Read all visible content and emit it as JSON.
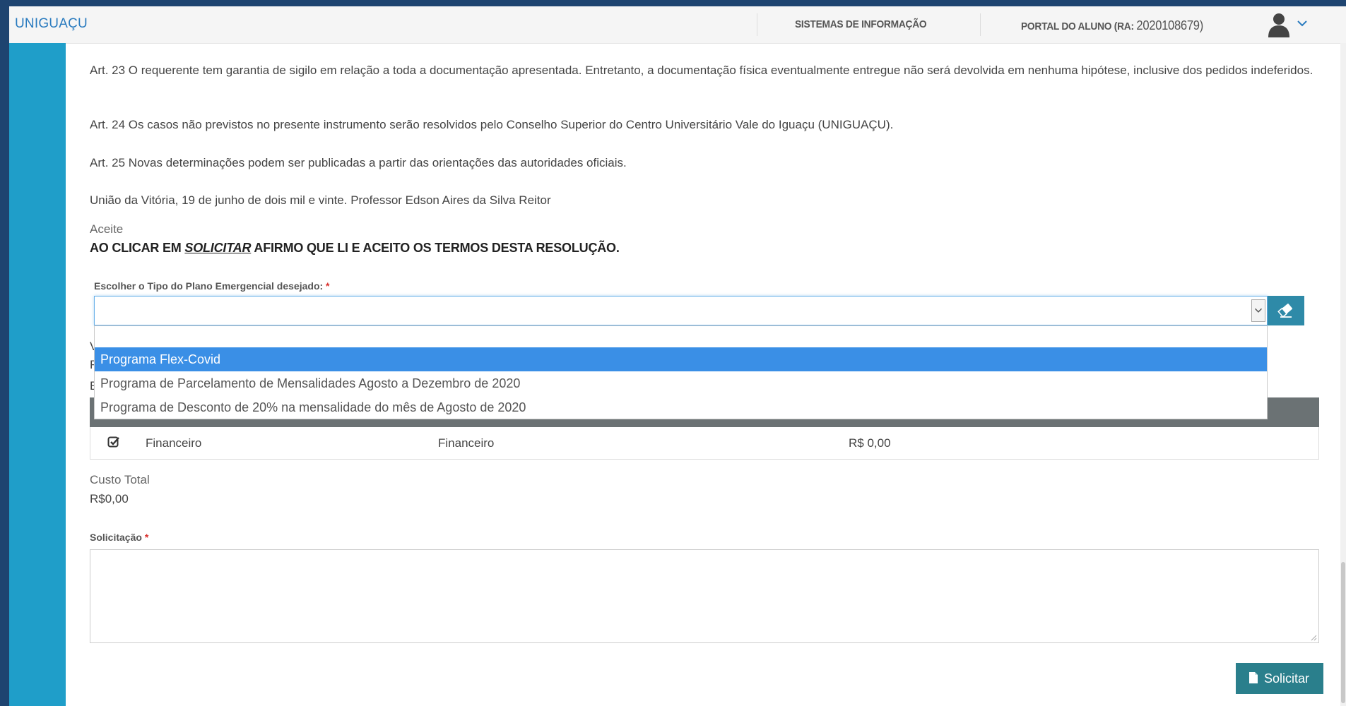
{
  "header": {
    "brand": "UNIGUAÇU",
    "nav_sistemas": "SISTEMAS DE INFORMAÇÃO",
    "nav_portal_prefix": "PORTAL DO ALUNO (RA:",
    "nav_portal_ra": "2020108679)",
    "user_icon": "user-icon",
    "menu_icon": "chevron-down-icon"
  },
  "content": {
    "art23": "Art. 23 O requerente tem garantia de sigilo em relação a toda a documentação apresentada. Entretanto, a documentação física eventualmente entregue não será devolvida em nenhuma hipótese, inclusive dos pedidos indeferidos.",
    "art24": "Art. 24 Os casos não previstos no presente instrumento serão resolvidos pelo Conselho Superior do Centro Universitário Vale do Iguaçu (UNIGUAÇU).",
    "art25": "Art. 25 Novas determinações podem ser publicadas a partir das orientações das autoridades oficiais.",
    "signature": "União da Vitória, 19 de junho de dois mil e vinte. Professor Edson Aires da Silva Reitor",
    "aceite_label": "Aceite",
    "aceite_pre": "AO CLICAR EM ",
    "aceite_em": "SOLICITAR",
    "aceite_post": " AFIRMO QUE LI E ACEITO OS TERMOS DESTA RESOLUÇÃO."
  },
  "plan_select": {
    "label": "Escolher o Tipo do Plano Emergencial desejado:",
    "required_mark": "*",
    "value": "",
    "clear_icon": "eraser-icon",
    "options": [
      "",
      "Programa Flex-Covid",
      "Programa de Parcelamento de Mensalidades Agosto a Dezembro de 2020",
      "Programa de Desconto de 20% na mensalidade do mês de Agosto de 2020"
    ],
    "highlighted_index": 1
  },
  "partially_hidden": {
    "line1": "V",
    "line2": "F",
    "line3": "E"
  },
  "table": {
    "rows": [
      {
        "check_icon": "check-square-icon",
        "col1": "Financeiro",
        "col2": "Financeiro",
        "col3": "R$ 0,00"
      }
    ]
  },
  "custo": {
    "label": "Custo Total",
    "value": "R$0,00"
  },
  "solicitacao": {
    "label": "Solicitação",
    "required_mark": "*",
    "value": ""
  },
  "submit": {
    "label": "Solicitar",
    "icon": "document-icon"
  },
  "colors": {
    "sidebar": "#1f9ec9",
    "brand": "#2a7bbf",
    "highlight": "#3a8fe6",
    "button": "#2a7f8c",
    "outer": "#1e4470"
  }
}
